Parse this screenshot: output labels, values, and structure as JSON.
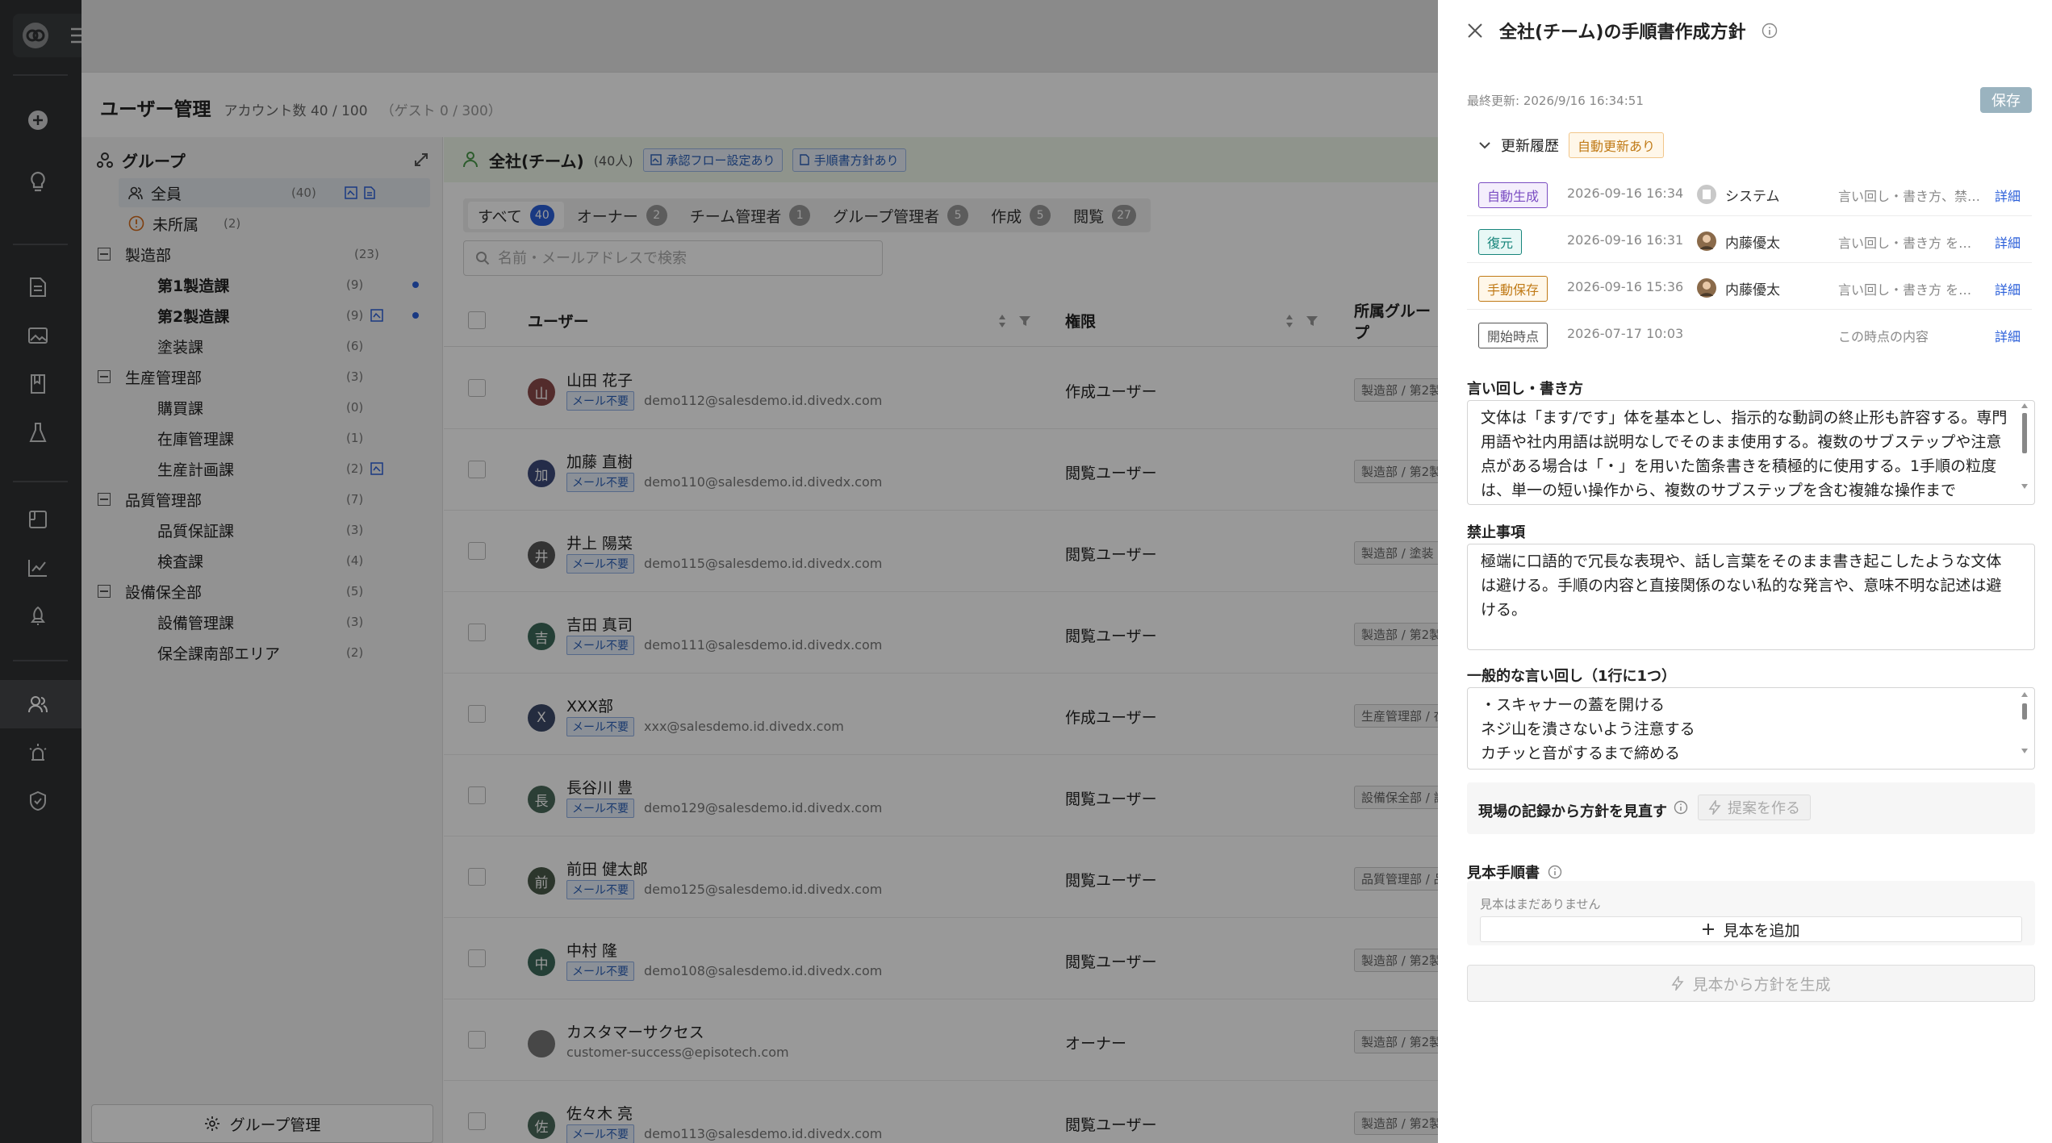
{
  "app": {
    "page_title": "ユーザー管理",
    "account_count": "アカウント数 40 / 100",
    "guest_count": "（ゲスト 0 / 300）"
  },
  "groups": {
    "title": "グループ",
    "manage_button": "グループ管理",
    "items": [
      {
        "name": "全員",
        "count": "(40)"
      },
      {
        "name": "未所属",
        "count": "(2)"
      },
      {
        "name": "製造部",
        "count": "(23)"
      },
      {
        "name": "第1製造課",
        "count": "(9)"
      },
      {
        "name": "第2製造課",
        "count": "(9)"
      },
      {
        "name": "塗装課",
        "count": "(6)"
      },
      {
        "name": "生産管理部",
        "count": "(3)"
      },
      {
        "name": "購買課",
        "count": "(0)"
      },
      {
        "name": "在庫管理課",
        "count": "(1)"
      },
      {
        "name": "生産計画課",
        "count": "(2)"
      },
      {
        "name": "品質管理部",
        "count": "(7)"
      },
      {
        "name": "品質保証課",
        "count": "(3)"
      },
      {
        "name": "検査課",
        "count": "(4)"
      },
      {
        "name": "設備保全部",
        "count": "(5)"
      },
      {
        "name": "設備管理課",
        "count": "(3)"
      },
      {
        "name": "保全課南部エリア",
        "count": "(2)"
      }
    ]
  },
  "team": {
    "name": "全社(チーム)",
    "count": "(40人)",
    "tag_flow": "承認フロー設定あり",
    "tag_policy": "手順書方針あり"
  },
  "tabs": [
    {
      "label": "すべて",
      "count": "40"
    },
    {
      "label": "オーナー",
      "count": "2"
    },
    {
      "label": "チーム管理者",
      "count": "1"
    },
    {
      "label": "グループ管理者",
      "count": "5"
    },
    {
      "label": "作成",
      "count": "5"
    },
    {
      "label": "閲覧",
      "count": "27"
    }
  ],
  "search": {
    "placeholder": "名前・メールアドレスで検索"
  },
  "table": {
    "col_user": "ユーザー",
    "col_role": "権限",
    "col_group": "所属グループ",
    "mail_tag": "メール不要",
    "rows": [
      {
        "initial": "山",
        "name": "山田 花子",
        "email": "demo112@salesdemo.id.divedx.com",
        "role": "作成ユーザー",
        "group": "製造部 / 第2製",
        "avatar_color": "#8a4a4a"
      },
      {
        "initial": "加",
        "name": "加藤 直樹",
        "email": "demo110@salesdemo.id.divedx.com",
        "role": "閲覧ユーザー",
        "group": "製造部 / 第2製",
        "avatar_color": "#3d4a7a"
      },
      {
        "initial": "井",
        "name": "井上 陽菜",
        "email": "demo115@salesdemo.id.divedx.com",
        "role": "閲覧ユーザー",
        "group": "製造部 / 塗装",
        "avatar_color": "#555555"
      },
      {
        "initial": "吉",
        "name": "吉田 真司",
        "email": "demo111@salesdemo.id.divedx.com",
        "role": "閲覧ユーザー",
        "group": "製造部 / 第2製",
        "avatar_color": "#3d6a5a"
      },
      {
        "initial": "X",
        "name": "XXX部",
        "email": "xxx@salesdemo.id.divedx.com",
        "role": "作成ユーザー",
        "group": "生産管理部 / 在",
        "avatar_color": "#3d4a6a"
      },
      {
        "initial": "長",
        "name": "長谷川 豊",
        "email": "demo129@salesdemo.id.divedx.com",
        "role": "閲覧ユーザー",
        "group": "設備保全部 / 設",
        "avatar_color": "#4a6a5a"
      },
      {
        "initial": "前",
        "name": "前田 健太郎",
        "email": "demo125@salesdemo.id.divedx.com",
        "role": "閲覧ユーザー",
        "group": "品質管理部 / 品",
        "avatar_color": "#4a5a4a"
      },
      {
        "initial": "中",
        "name": "中村 隆",
        "email": "demo108@salesdemo.id.divedx.com",
        "role": "閲覧ユーザー",
        "group": "製造部 / 第2製",
        "avatar_color": "#3d6a5a"
      },
      {
        "initial": "",
        "name": "カスタマーサクセス",
        "email": "customer-success@episotech.com",
        "role": "オーナー",
        "group": "製造部 / 第2製",
        "avatar_color": "#777777"
      },
      {
        "initial": "佐",
        "name": "佐々木 亮",
        "email": "demo113@salesdemo.id.divedx.com",
        "role": "閲覧ユーザー",
        "group": "製造部 / 第2製",
        "avatar_color": "#4a6a5a"
      }
    ]
  },
  "drawer": {
    "title": "全社(チーム)の手順書作成方針",
    "last_updated": "最終更新: 2026/9/16 16:34:51",
    "save": "保存",
    "history_label": "更新履歴",
    "auto_update_tag": "自動更新あり",
    "history": [
      {
        "type": "自動生成",
        "date": "2026-09-16 16:34",
        "user": "システム",
        "desc": "言い回し・書き方、禁…",
        "link": "詳細"
      },
      {
        "type": "復元",
        "date": "2026-09-16 16:31",
        "user": "内藤優太",
        "desc": "言い回し・書き方 を…",
        "link": "詳細"
      },
      {
        "type": "手動保存",
        "date": "2026-09-16 15:36",
        "user": "内藤優太",
        "desc": "言い回し・書き方 を…",
        "link": "詳細"
      },
      {
        "type": "開始時点",
        "date": "2026-07-17 10:03",
        "user": "",
        "desc": "この時点の内容",
        "link": "詳細"
      }
    ],
    "style_label": "言い回し・書き方",
    "style_text": "文体は「ます/です」体を基本とし、指示的な動詞の終止形も許容する。専門用語や社内用語は説明なしでそのまま使用する。複数のサブステップや注意点がある場合は「・」を用いた箇条書きを積極的に使用する。1手順の粒度は、単一の短い操作から、複数のサブステップを含む複雑な操作まで",
    "prohibit_label": "禁止事項",
    "prohibit_text": "極端に口語的で冗長な表現や、話し言葉をそのまま書き起こしたような文体は避ける。手順の内容と直接関係のない私的な発言や、意味不明な記述は避ける。",
    "phrases_label": "一般的な言い回し（1行に1つ）",
    "phrases_text": "・スキャナーの蓋を開ける\nネジ山を潰さないよう注意する\nカチッと音がするまで締める",
    "review_label": "現場の記録から方針を見直す",
    "suggest_button": "提案を作る",
    "samples_label": "見本手順書",
    "samples_empty": "見本はまだありません",
    "add_sample": "見本を追加",
    "generate_button": "見本から方針を生成"
  }
}
